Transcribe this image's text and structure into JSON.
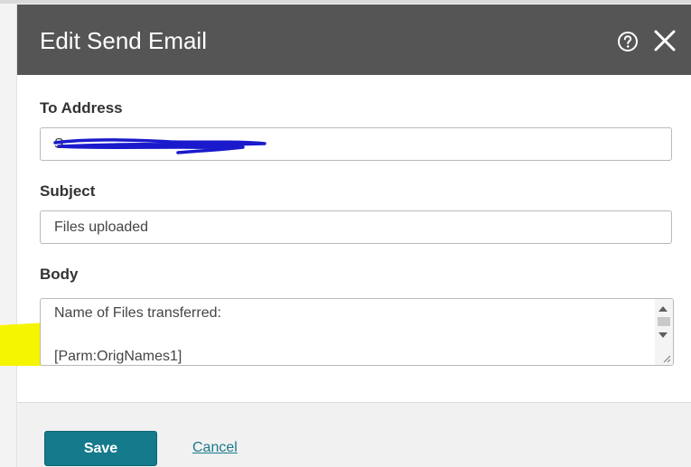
{
  "dialog": {
    "title": "Edit Send Email",
    "help_icon": "question-circle-icon",
    "close_icon": "close-icon"
  },
  "form": {
    "to_address": {
      "label": "To Address",
      "value": "S"
    },
    "subject": {
      "label": "Subject",
      "value": "Files uploaded"
    },
    "body": {
      "label": "Body",
      "value": "Name of Files transferred:\n\n[Parm:OrigNames1]"
    }
  },
  "footer": {
    "save_label": "Save",
    "cancel_label": "Cancel"
  },
  "colors": {
    "header_bg": "#555555",
    "primary": "#147a8c",
    "highlight": "#f5f500",
    "redaction": "#1a1acc"
  }
}
